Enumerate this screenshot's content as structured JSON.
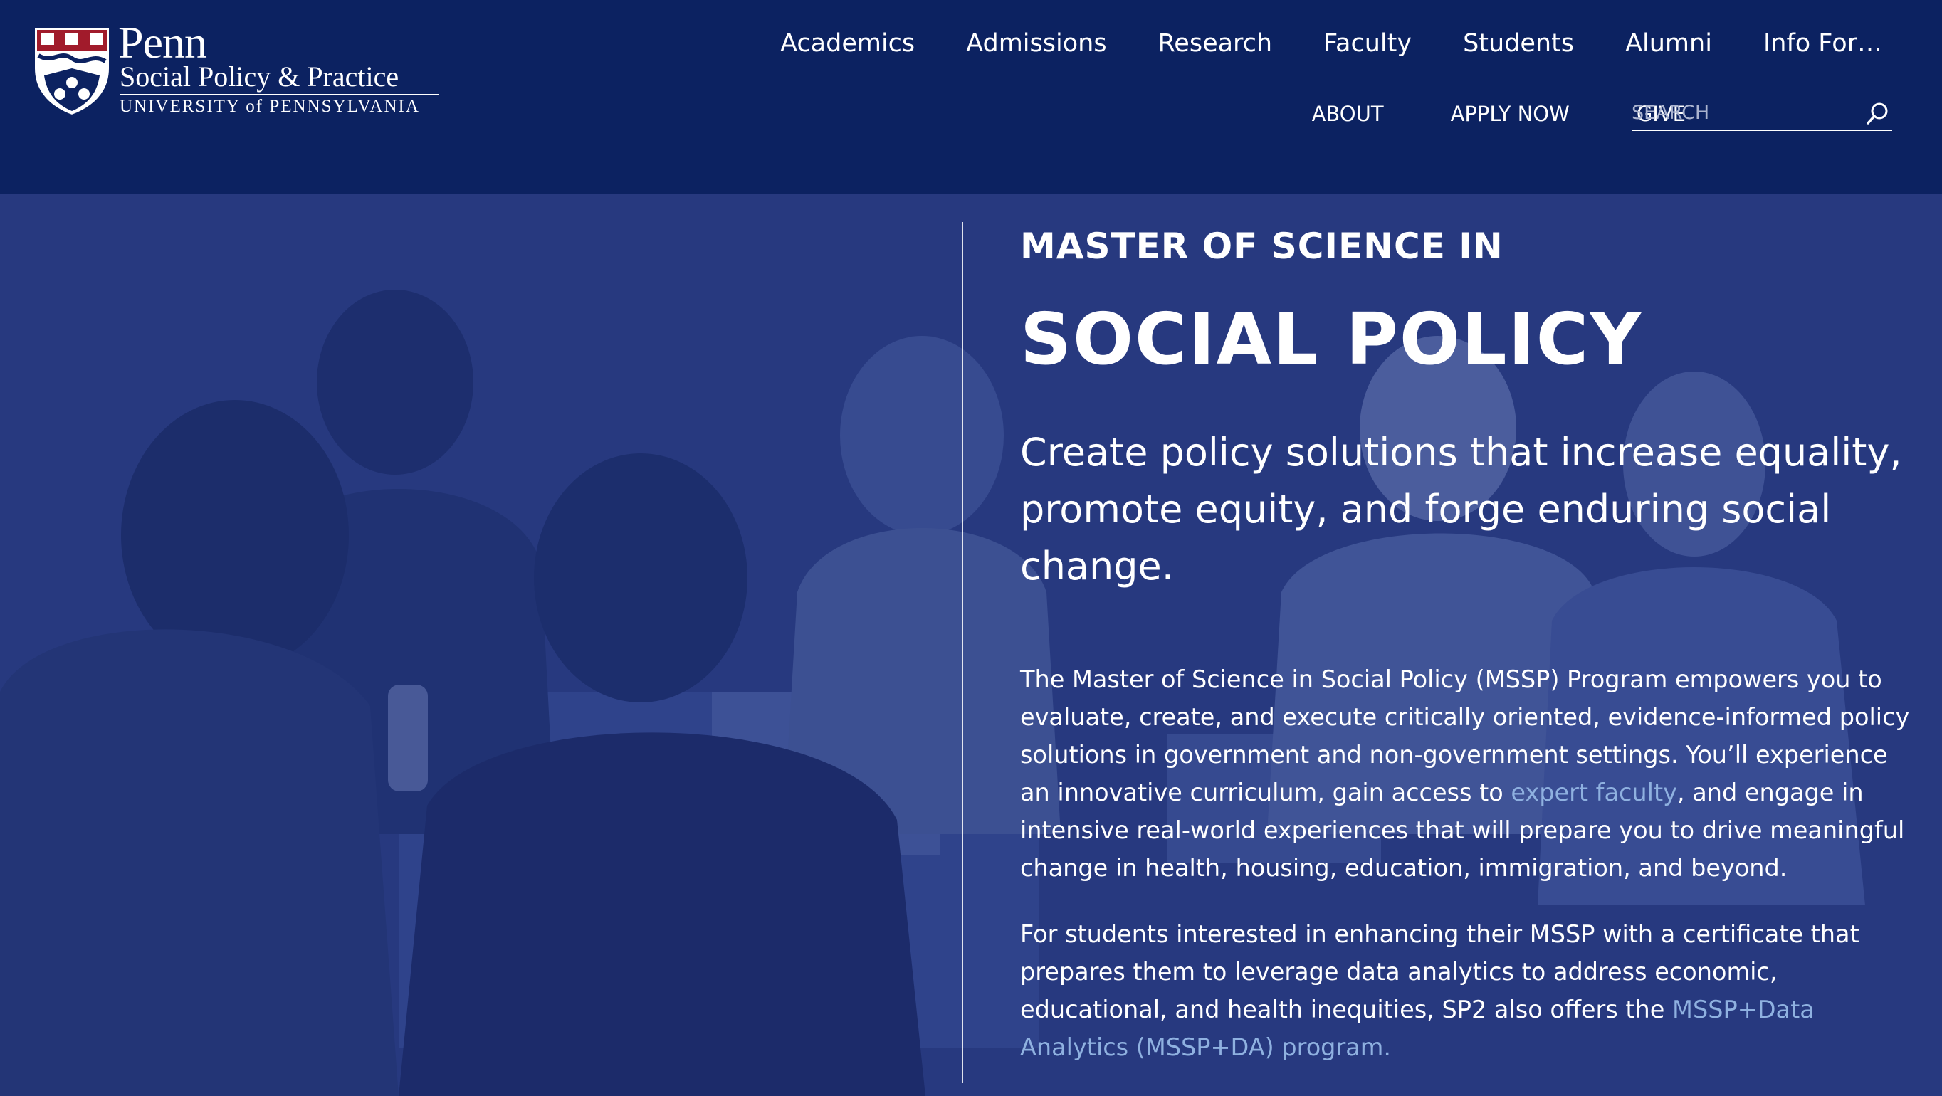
{
  "logo": {
    "penn": "Penn",
    "school": "Social Policy & Practice",
    "university": "UNIVERSITY of PENNSYLVANIA"
  },
  "main_nav": [
    {
      "label": "Academics"
    },
    {
      "label": "Admissions"
    },
    {
      "label": "Research"
    },
    {
      "label": "Faculty"
    },
    {
      "label": "Students"
    },
    {
      "label": "Alumni"
    },
    {
      "label": "Info For…"
    }
  ],
  "util_nav": [
    {
      "label": "ABOUT"
    },
    {
      "label": "APPLY NOW"
    },
    {
      "label": "GIVE"
    }
  ],
  "search": {
    "placeholder": "SEARCH",
    "icon": "search-icon"
  },
  "hero": {
    "eyebrow": "MASTER OF SCIENCE IN",
    "title": "SOCIAL POLICY",
    "tagline": "Create policy solutions that increase equality, promote equity, and forge enduring social change.",
    "p1_before": "The Master of Science in Social Policy (MSSP) Program empowers you to evaluate, create, and execute critically oriented, evidence-informed policy solutions in government and non-government settings. You’ll experience an innovative curriculum, gain access to ",
    "p1_link": "expert faculty",
    "p1_after": ", and engage in intensive real-world experiences that will prepare you to drive meaningful change in health, housing, education, immigration, and beyond.",
    "p2_before": "For students interested in enhancing their MSSP with a certificate that prepares them to leverage data analytics to address economic, educational, and health inequities, SP2 also offers the ",
    "p2_link": "MSSP+Data Analytics (MSSP+DA) program."
  },
  "colors": {
    "header_bg": "#0c2261",
    "overlay": "#1e3282",
    "link": "#8fb1e0",
    "shield_red": "#a11b2b"
  }
}
